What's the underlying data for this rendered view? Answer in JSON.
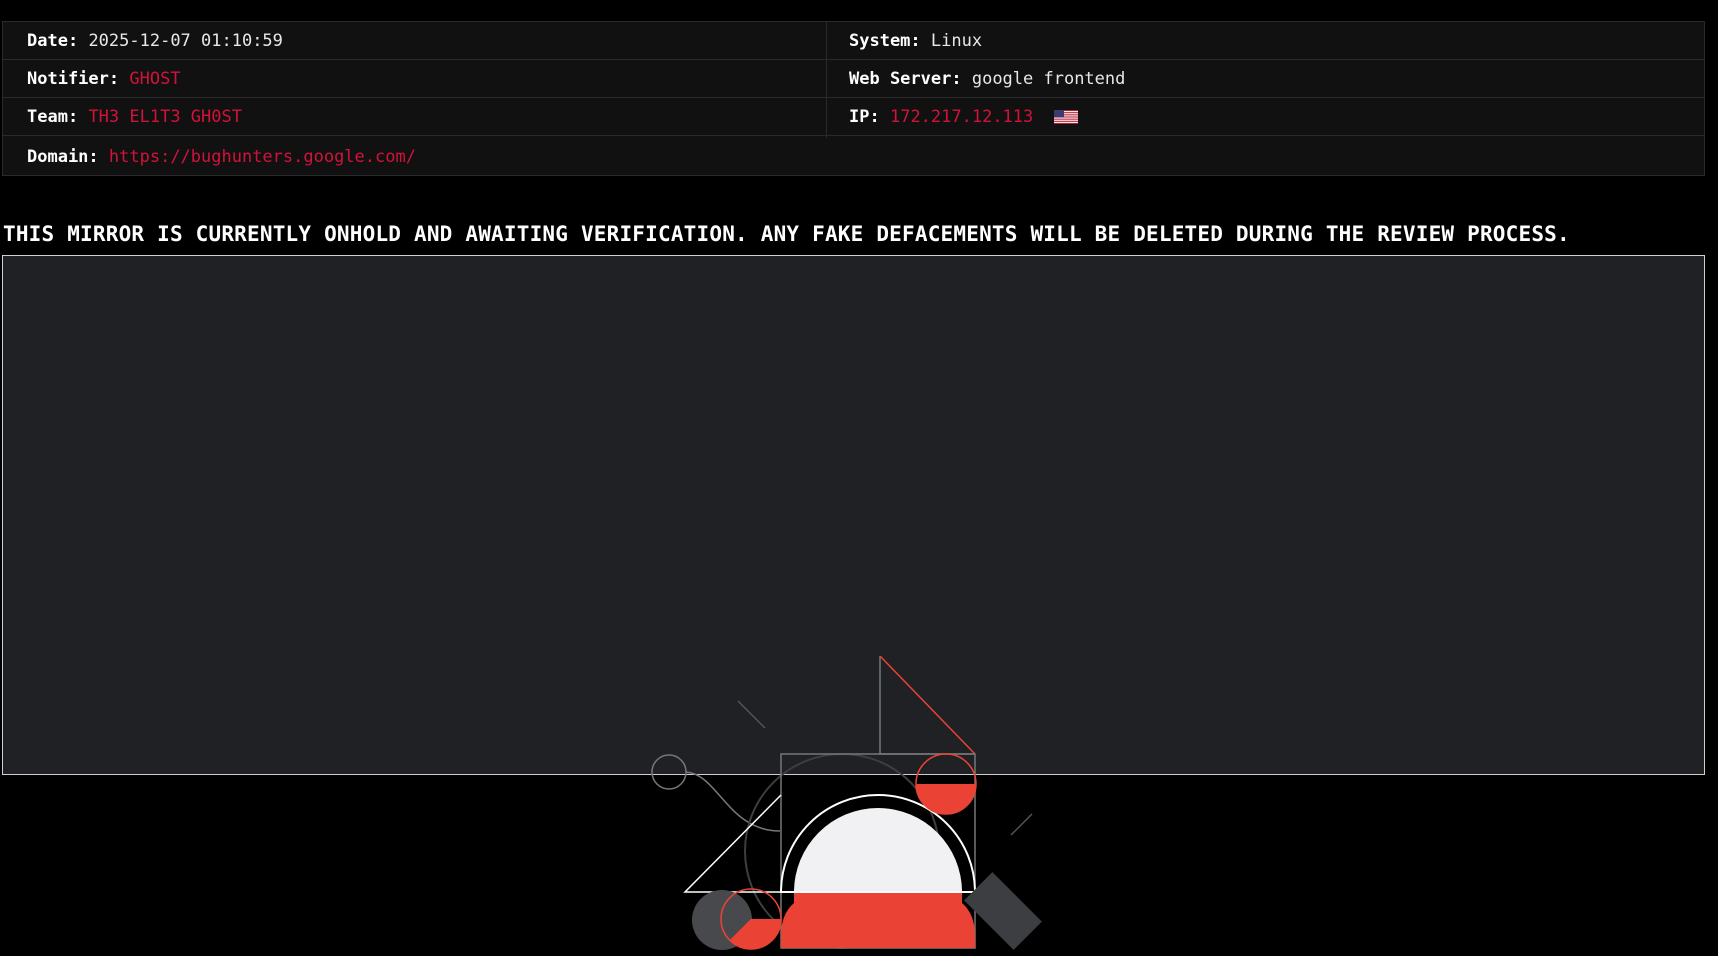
{
  "info": {
    "date_label": "Date:",
    "date_value": "2025-12-07 01:10:59",
    "system_label": "System:",
    "system_value": "Linux",
    "notifier_label": "Notifier:",
    "notifier_value": "GHOST",
    "webserver_label": "Web Server:",
    "webserver_value": "google frontend",
    "team_label": "Team:",
    "team_value": "TH3 EL1T3 GH0ST",
    "ip_label": "IP:",
    "ip_value": "172.217.12.113",
    "ip_flag_icon": "us-flag-icon",
    "domain_label": "Domain:",
    "domain_value": "https://bughunters.google.com/"
  },
  "notice": "THIS MIRROR IS CURRENTLY ONHOLD AND AWAITING VERIFICATION. ANY FAKE DEFACEMENTS WILL BE DELETED DURING THE REVIEW PROCESS.",
  "colors": {
    "accent_red": "#d3123a",
    "illustration_red": "#ea4335",
    "frame_bg": "#202125"
  }
}
